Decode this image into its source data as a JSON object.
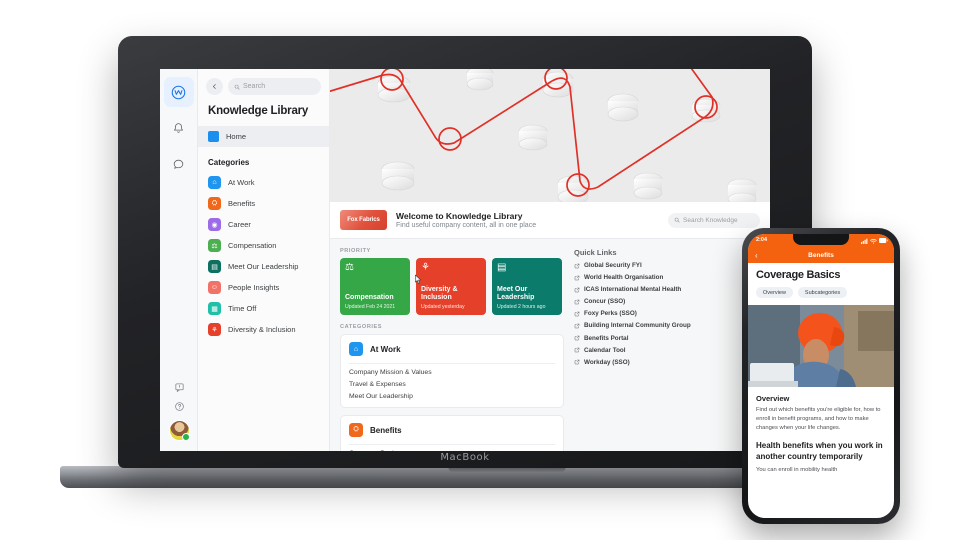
{
  "device": {
    "laptop_label": "MacBook"
  },
  "rail": {
    "logo_icon": "workplace-logo-icon",
    "items": [
      {
        "name": "home-logo",
        "icon": "circle-w-icon"
      },
      {
        "name": "notifications",
        "icon": "bell-icon"
      },
      {
        "name": "messages",
        "icon": "chat-bubble-icon"
      }
    ],
    "bottom": [
      {
        "name": "feedback",
        "icon": "feedback-icon"
      },
      {
        "name": "help",
        "icon": "help-circle-icon"
      },
      {
        "name": "profile",
        "icon": "avatar-icon"
      }
    ]
  },
  "navpane": {
    "back_icon": "arrow-left-icon",
    "search_placeholder": "Search",
    "search_icon": "search-icon",
    "title": "Knowledge Library",
    "home_label": "Home",
    "categories_heading": "Categories",
    "categories": [
      {
        "label": "At Work",
        "color": "#1e96ef",
        "glyph": "⌂"
      },
      {
        "label": "Benefits",
        "color": "#f0681b",
        "glyph": "⛭"
      },
      {
        "label": "Career",
        "color": "#9b6be8",
        "glyph": "◉"
      },
      {
        "label": "Compensation",
        "color": "#4caf50",
        "glyph": "⚖"
      },
      {
        "label": "Meet Our Leadership",
        "color": "#0d7060",
        "glyph": "▤"
      },
      {
        "label": "People Insights",
        "color": "#f37268",
        "glyph": "☺"
      },
      {
        "label": "Time Off",
        "color": "#1fbfa8",
        "glyph": "▦"
      },
      {
        "label": "Diversity & Inclusion",
        "color": "#e5402a",
        "glyph": "⚘"
      }
    ]
  },
  "welcome": {
    "brand": "Fox Fabrics",
    "title": "Welcome to Knowledge Library",
    "subtitle": "Find useful company content, all in one place",
    "search_placeholder": "Search Knowledge",
    "search_icon": "search-icon"
  },
  "priority": {
    "heading": "PRIORITY",
    "cards": [
      {
        "title": "Compensation",
        "updated": "Updated Feb 24 2021",
        "color": "#35a747",
        "glyph": "⚖"
      },
      {
        "title": "Diversity & Inclusion",
        "updated": "Updated yesterday",
        "color": "#e5402a",
        "glyph": "⚘"
      },
      {
        "title": "Meet Our Leadership",
        "updated": "Updated 2 hours ago",
        "color": "#0b7b6b",
        "glyph": "▤"
      }
    ]
  },
  "categories_section": {
    "heading": "CATEGORIES",
    "cards": [
      {
        "title": "At Work",
        "color": "#1e96ef",
        "glyph": "⌂",
        "links": [
          "Company Mission & Values",
          "Travel & Expenses",
          "Meet Our Leadership"
        ]
      },
      {
        "title": "Benefits",
        "color": "#f0681b",
        "glyph": "⛭",
        "links": [
          "Coverage Basics"
        ]
      }
    ]
  },
  "quick_links": {
    "heading": "Quick Links",
    "link_icon": "external-link-icon",
    "items": [
      "Global Security FYI",
      "World Health Organisation",
      "ICAS International Mental Health",
      "Concur (SSO)",
      "Foxy Perks (SSO)",
      "Building Internal Community Group",
      "Benefits Portal",
      "Calendar Tool",
      "Workday (SSO)"
    ]
  },
  "phone": {
    "status_time": "2:04",
    "nav_title": "Benefits",
    "back_icon": "chevron-left-icon",
    "heading": "Coverage Basics",
    "tabs": [
      "Overview",
      "Subcategories"
    ],
    "section_title": "Overview",
    "section_body": "Find out which benefits you're eligible for, how to enroll in benefit programs, and how to make changes when your life changes.",
    "subsection_title": "Health benefits when you work in another country temporarily",
    "subsection_body": "You can enroll in mobility health",
    "accent_color": "#f4620f"
  }
}
